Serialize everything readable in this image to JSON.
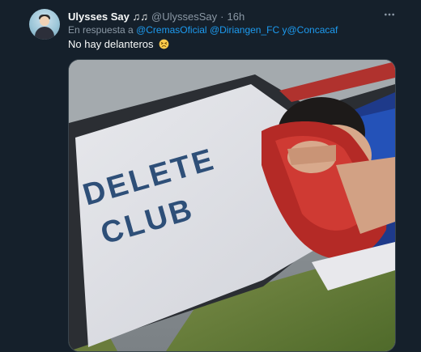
{
  "tweet": {
    "author_name": "Ulysses Say",
    "author_music": "♫♫",
    "handle": "@UlyssesSay",
    "separator": "·",
    "time": "16h",
    "reply_prefix": "En respuesta a",
    "mentions": [
      "@CremasOficial",
      "@Diriangen_FC",
      "@Concacaf"
    ],
    "mention_joiner": "y",
    "text": "No hay delanteros",
    "image_text_line1": "DELETE",
    "image_text_line2": "CLUB",
    "more_icon": "more-dots-icon"
  },
  "colors": {
    "background": "#15202b",
    "primary_text": "#f7f9f9",
    "secondary_text": "#8b98a5",
    "link": "#1d9bf0"
  }
}
